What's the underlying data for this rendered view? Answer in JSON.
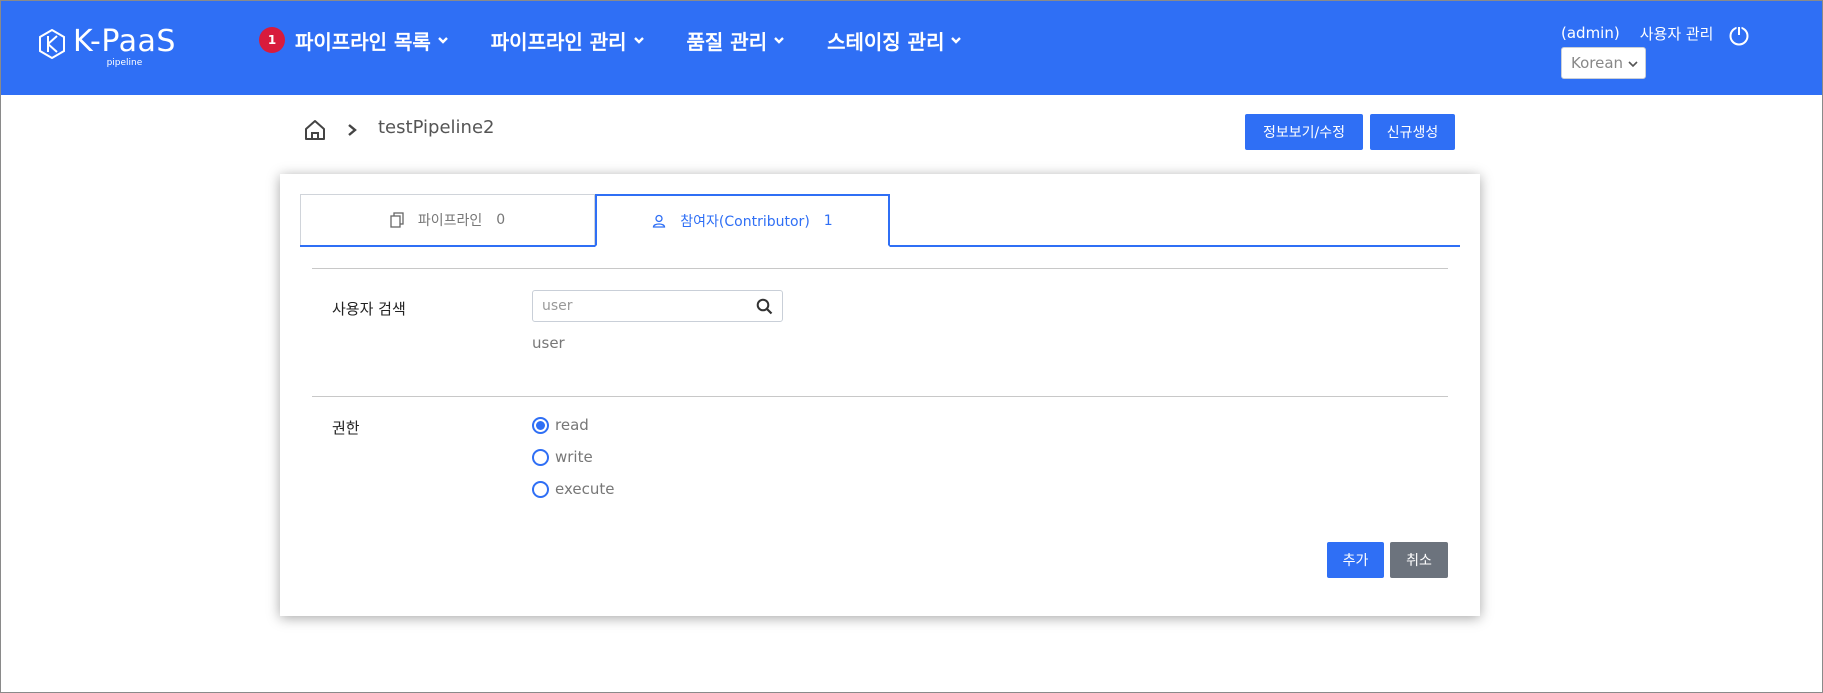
{
  "colors": {
    "primary": "#2f6ff5",
    "badge": "#d81b3c",
    "cancel": "#6c737d"
  },
  "header": {
    "logo_title": "K-PaaS",
    "logo_sub": "pipeline",
    "nav": [
      {
        "label": "파이프라인 목록",
        "badge": "1"
      },
      {
        "label": "파이프라인 관리"
      },
      {
        "label": "품질 관리"
      },
      {
        "label": "스테이징 관리"
      }
    ],
    "user": "(admin)",
    "user_manage": "사용자 관리",
    "language": "Korean"
  },
  "breadcrumb": {
    "current": "testPipeline2"
  },
  "actions": {
    "view_edit": "정보보기/수정",
    "create": "신규생성"
  },
  "tabs": [
    {
      "label": "파이프라인",
      "count": "0",
      "icon": "copy-icon"
    },
    {
      "label": "참여자(Contributor)",
      "count": "1",
      "icon": "person-icon"
    }
  ],
  "form": {
    "user_search_label": "사용자 검색",
    "user_search_placeholder": "user",
    "user_hint": "user",
    "permission_label": "권한",
    "permissions": [
      {
        "label": "read",
        "checked": true
      },
      {
        "label": "write",
        "checked": false
      },
      {
        "label": "execute",
        "checked": false
      }
    ],
    "add_label": "추가",
    "cancel_label": "취소"
  }
}
